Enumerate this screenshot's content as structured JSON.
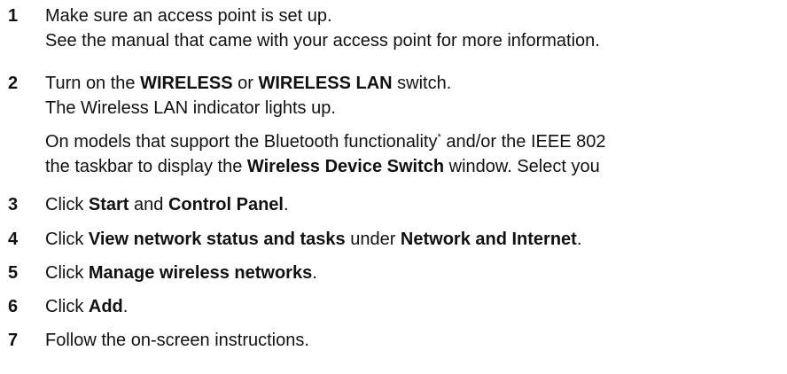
{
  "steps": [
    {
      "number": "1",
      "lines": [
        "Make sure an access point is set up.",
        "See the manual that came with your access point for more information."
      ]
    },
    {
      "number": "2",
      "line1": {
        "t1": "Turn on the ",
        "b1": "WIRELESS",
        "t2": " or ",
        "b2": "WIRELESS LAN",
        "t3": " switch."
      },
      "line2": "The Wireless LAN indicator lights up.",
      "line3": {
        "t1": "On models that support the Bluetooth functionality",
        "sup": "*",
        "t2": " and/or the IEEE 802"
      },
      "line4": {
        "t1": "the taskbar to display the ",
        "b1": "Wireless Device Switch",
        "t2": " window. Select you"
      }
    },
    {
      "number": "3",
      "t1": "Click ",
      "b1": "Start",
      "t2": " and ",
      "b2": "Control Panel",
      "t3": "."
    },
    {
      "number": "4",
      "t1": "Click ",
      "b1": "View network status and tasks",
      "t2": " under ",
      "b2": "Network and Internet",
      "t3": "."
    },
    {
      "number": "5",
      "t1": "Click ",
      "b1": "Manage wireless networks",
      "t2": "."
    },
    {
      "number": "6",
      "t1": "Click ",
      "b1": "Add",
      "t2": "."
    },
    {
      "number": "7",
      "t1": "Follow the on-screen instructions."
    }
  ]
}
